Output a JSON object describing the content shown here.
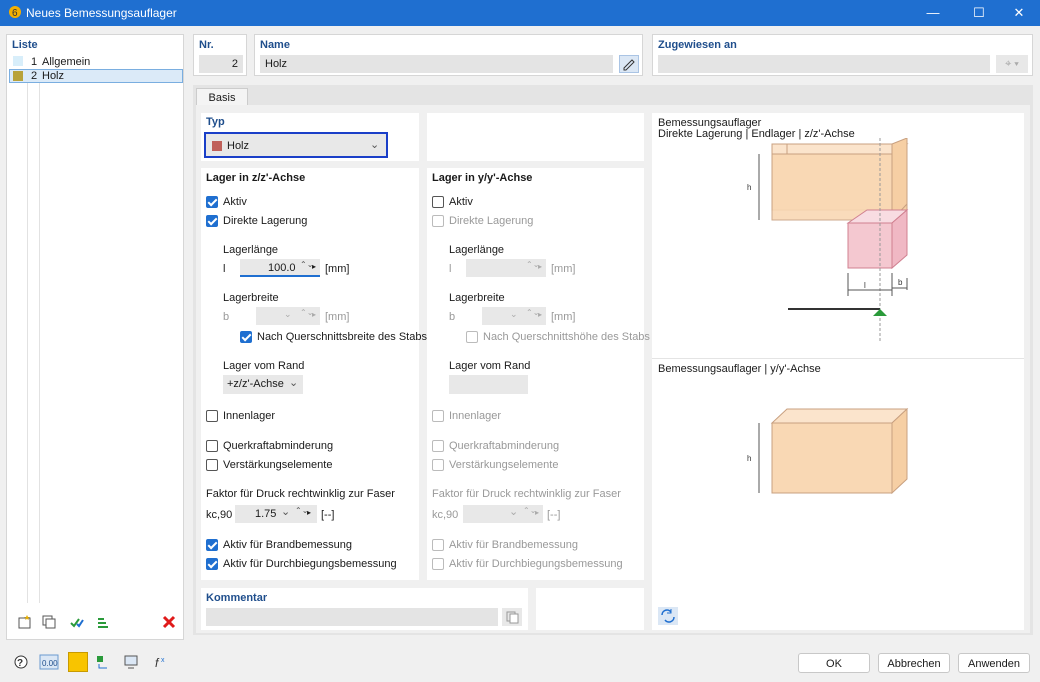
{
  "window": {
    "title": "Neues Bemessungsauflager",
    "minimize": "—",
    "maximize": "☐",
    "close": "✕"
  },
  "list": {
    "header": "Liste",
    "items": [
      {
        "num": "1",
        "label": "Allgemein",
        "color": "#d8eefa"
      },
      {
        "num": "2",
        "label": "Holz",
        "color": "#b8a23a"
      }
    ]
  },
  "nr": {
    "label": "Nr.",
    "value": "2"
  },
  "name": {
    "label": "Name",
    "value": "Holz"
  },
  "assigned": {
    "label": "Zugewiesen an",
    "value": ""
  },
  "tabs": [
    {
      "label": "Basis"
    }
  ],
  "typ": {
    "label": "Typ",
    "value": "Holz",
    "color": "#c0605a"
  },
  "zz": {
    "header": "Lager in z/z'-Achse",
    "aktiv": "Aktiv",
    "direkt": "Direkte Lagerung",
    "laenge_label": "Lagerlänge",
    "laenge_sym": "l",
    "laenge_val": "100.0",
    "unit": "[mm]",
    "breite_label": "Lagerbreite",
    "breite_sym": "b",
    "breite_val": "",
    "nach": "Nach Querschnittsbreite des Stabs",
    "rand_label": "Lager vom Rand",
    "rand_val": "+z/z'-Achse",
    "innen": "Innenlager",
    "querkraft": "Querkraftabminderung",
    "verst": "Verstärkungselemente",
    "faktor": "Faktor für Druck rechtwinklig zur Faser",
    "kc": "kc,90",
    "kc_val": "1.75",
    "kc_unit": "[--]",
    "brand": "Aktiv für Brandbemessung",
    "durch": "Aktiv für Durchbiegungsbemessung"
  },
  "yy": {
    "header": "Lager in y/y'-Achse",
    "aktiv": "Aktiv",
    "direkt": "Direkte Lagerung",
    "laenge_label": "Lagerlänge",
    "laenge_sym": "l",
    "unit": "[mm]",
    "breite_label": "Lagerbreite",
    "breite_sym": "b",
    "nach": "Nach Querschnittshöhe des Stabs",
    "rand_label": "Lager vom Rand",
    "innen": "Innenlager",
    "querkraft": "Querkraftabminderung",
    "verst": "Verstärkungselemente",
    "faktor": "Faktor für Druck rechtwinklig zur Faser",
    "kc": "kc,90",
    "kc_unit": "[--]",
    "brand": "Aktiv für Brandbemessung",
    "durch": "Aktiv für Durchbiegungsbemessung"
  },
  "kommentar": {
    "label": "Kommentar",
    "value": ""
  },
  "diagram1": {
    "title": "Bemessungsauflager",
    "subtitle": "Direkte Lagerung | Endlager | z/z'-Achse",
    "h": "h",
    "l": "l",
    "b": "b"
  },
  "diagram2": {
    "title": "Bemessungsauflager | y/y'-Achse",
    "h": "h"
  },
  "buttons": {
    "ok": "OK",
    "cancel": "Abbrechen",
    "apply": "Anwenden"
  },
  "colors": {
    "accent": "#1f6fd0",
    "wood": "#f9d8b4",
    "pink": "#f4c8d0"
  }
}
